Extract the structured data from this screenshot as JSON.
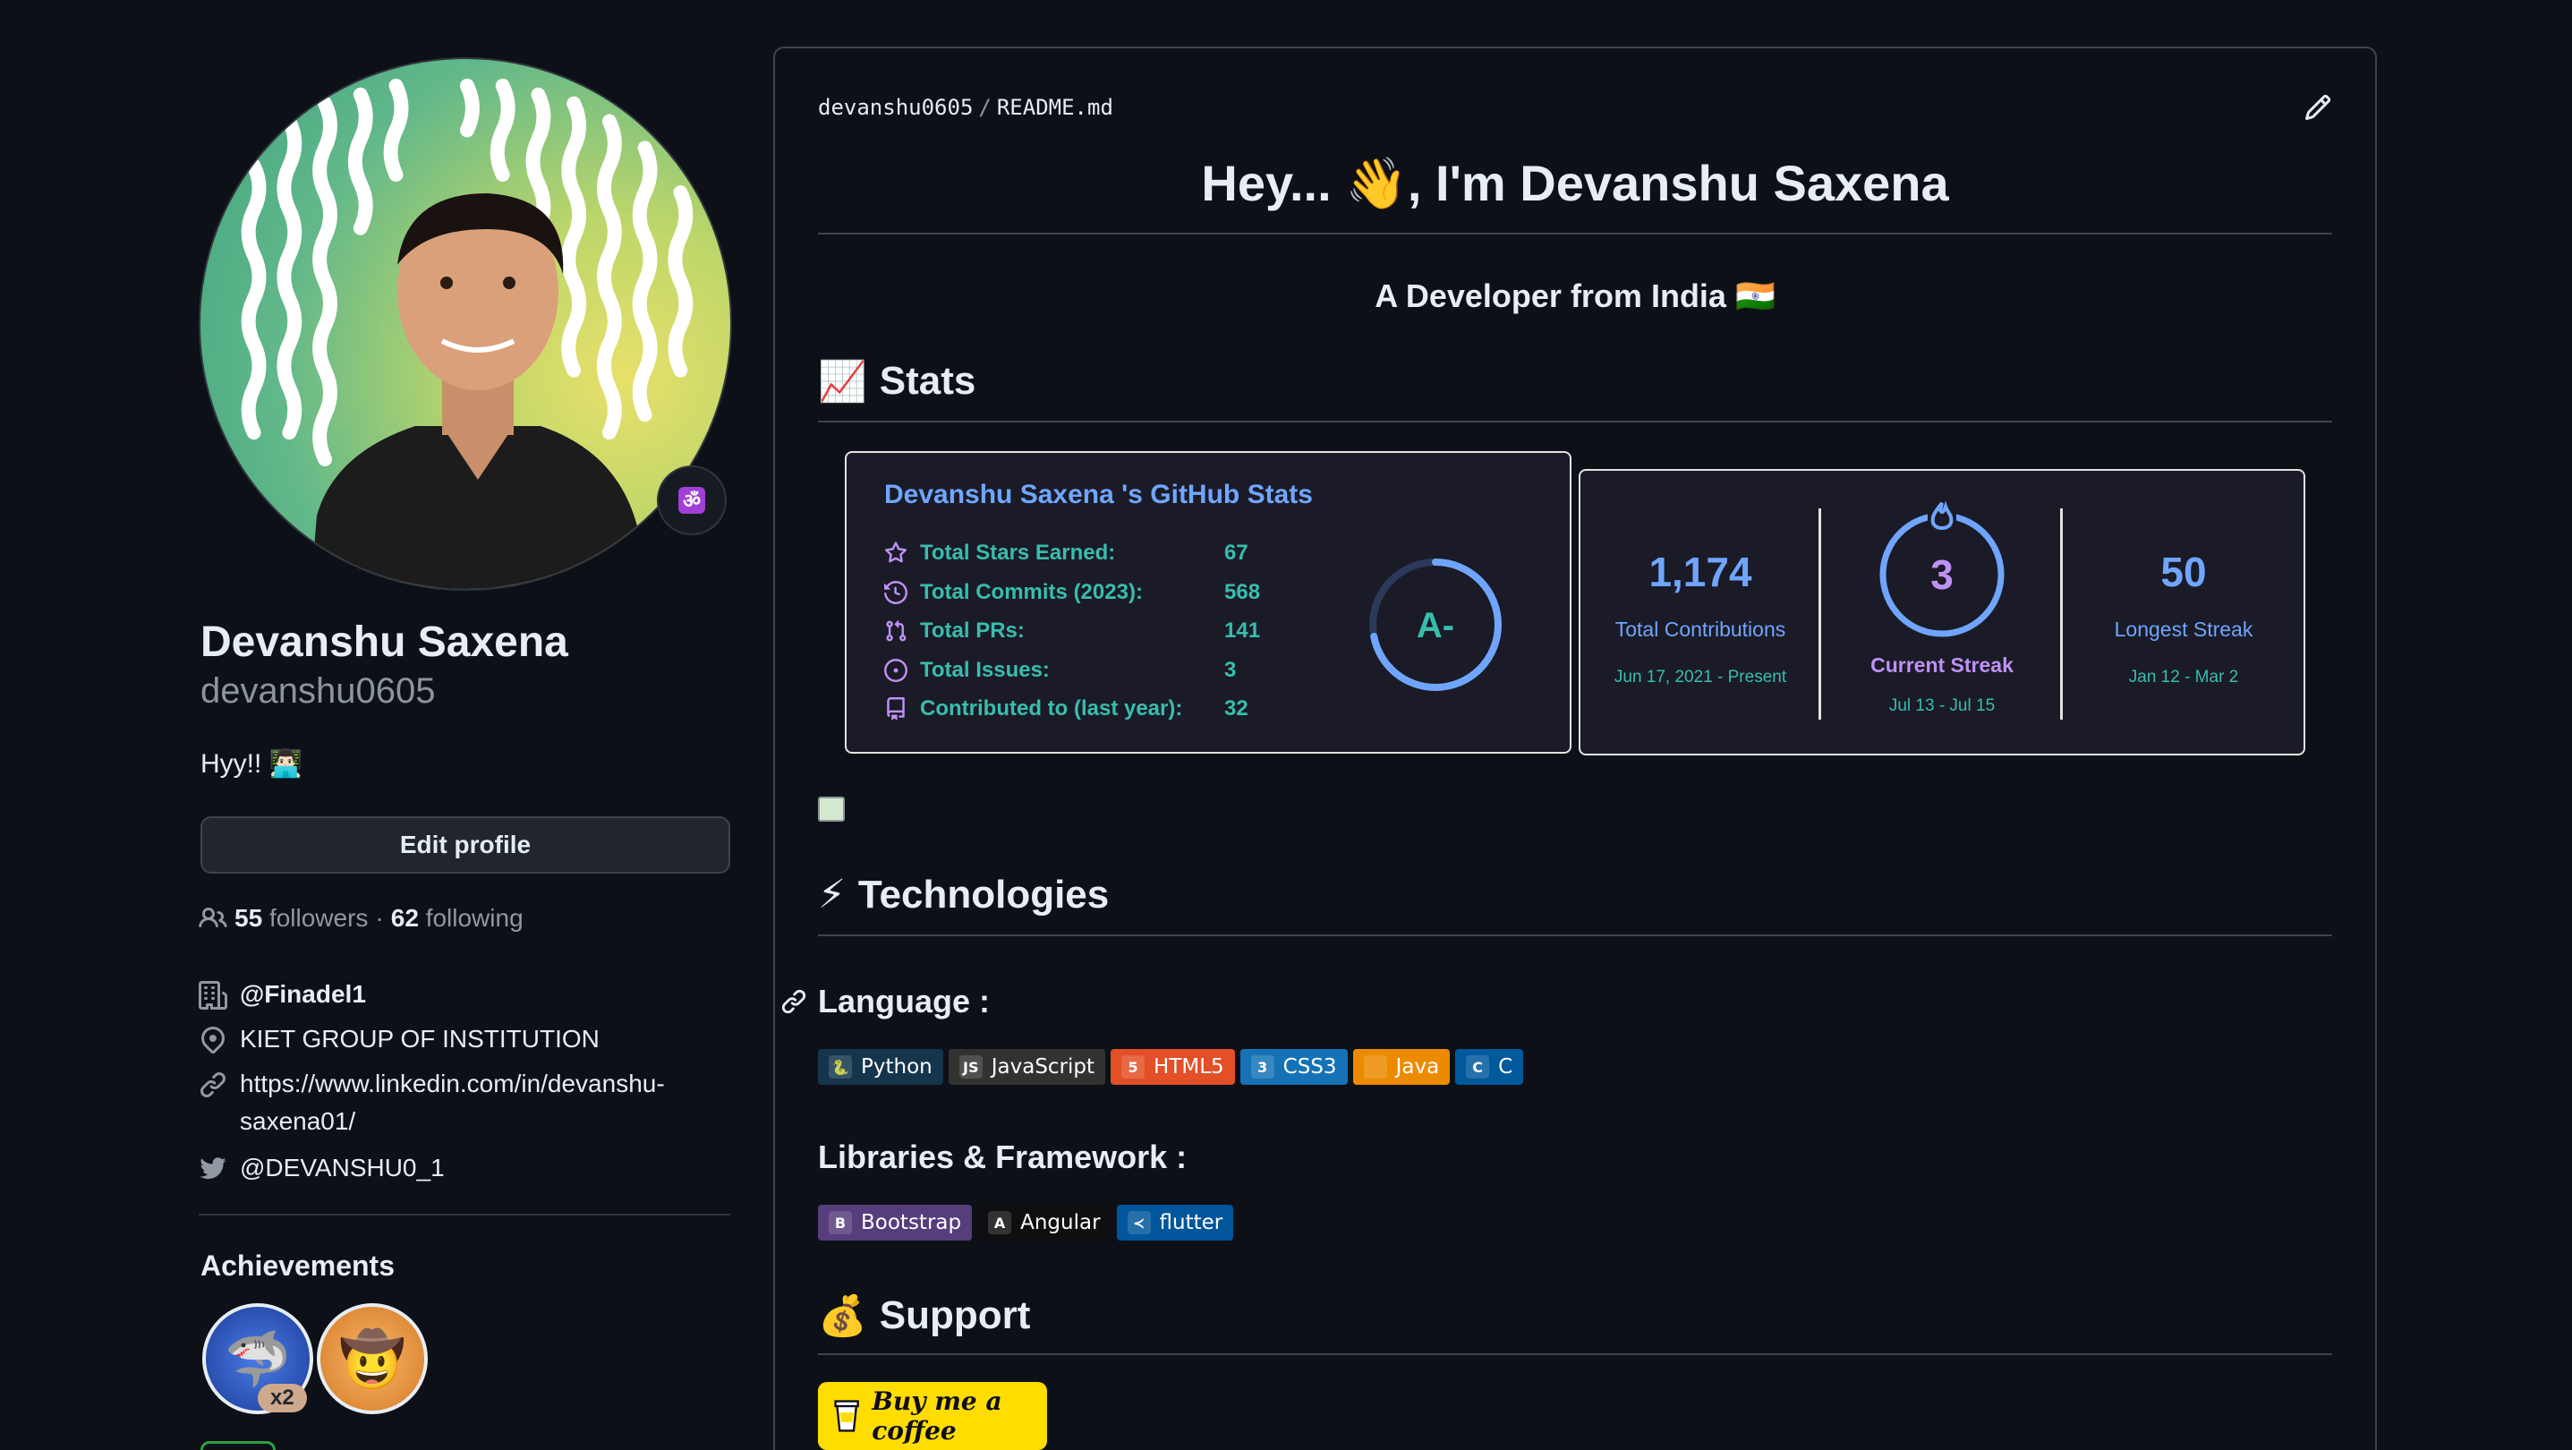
{
  "profile": {
    "full_name": "Devanshu Saxena",
    "username": "devanshu0605",
    "bio": "Hyy!! 👨🏻‍💻",
    "status_emoji": "ॐ",
    "edit_profile_label": "Edit profile",
    "followers_count": "55",
    "followers_label": "followers",
    "separator": "·",
    "following_count": "62",
    "following_label": "following",
    "organization": "@Finadel1",
    "location": "KIET GROUP OF INSTITUTION",
    "website_line1": "https://www.linkedin.com/in/devanshu-",
    "website_line2": "saxena01/",
    "twitter": "@DEVANSHU0_1",
    "achievements_title": "Achievements",
    "achievement_multiplier": "x2"
  },
  "readme": {
    "path_owner": "devanshu0605",
    "path_sep": "/",
    "path_file": "README.md",
    "heading": "Hey... 👋, I'm Devanshu Saxena",
    "subtitle": "A Developer from India 🇮🇳",
    "stats_heading_emoji": "📈",
    "stats_heading": "Stats",
    "tech_heading_emoji": "⚡",
    "tech_heading": "Technologies",
    "language_heading": "Language :",
    "libraries_heading": "Libraries & Framework :",
    "support_heading_emoji": "💰",
    "support_heading": "Support",
    "coffee_label": "Buy me a coffee"
  },
  "github_stats": {
    "title": "Devanshu Saxena 's GitHub Stats",
    "rows": [
      {
        "label": "Total Stars Earned:",
        "value": "67",
        "icon": "star-icon"
      },
      {
        "label": "Total Commits (2023):",
        "value": "568",
        "icon": "history-icon"
      },
      {
        "label": "Total PRs:",
        "value": "141",
        "icon": "pull-request-icon"
      },
      {
        "label": "Total Issues:",
        "value": "3",
        "icon": "issue-icon"
      },
      {
        "label": "Contributed to (last year):",
        "value": "32",
        "icon": "repo-icon"
      }
    ],
    "rank": "A-",
    "rank_progress": 0.72,
    "colors": {
      "title": "#70a5fd",
      "text": "#38bdae",
      "icon": "#bf91f3",
      "bg": "#1a1b27"
    }
  },
  "streak": {
    "total": "1,174",
    "total_label": "Total Contributions",
    "total_range": "Jun 17, 2021 - Present",
    "current": "3",
    "current_label": "Current Streak",
    "current_range": "Jul 13 - Jul 15",
    "longest": "50",
    "longest_label": "Longest Streak",
    "longest_range": "Jan 12 - Mar 2"
  },
  "languages": [
    {
      "label": "Python",
      "bg": "#14354c",
      "icon": "python-icon",
      "glyph": "🐍"
    },
    {
      "label": "JavaScript",
      "bg": "#323330",
      "icon": "javascript-icon",
      "glyph": "JS"
    },
    {
      "label": "HTML5",
      "bg": "#e34f26",
      "icon": "html5-icon",
      "glyph": "5"
    },
    {
      "label": "CSS3",
      "bg": "#1572b6",
      "icon": "css3-icon",
      "glyph": "3"
    },
    {
      "label": "Java",
      "bg": "#ed8b00",
      "icon": "java-icon",
      "glyph": ""
    },
    {
      "label": "C",
      "bg": "#00599c",
      "icon": "c-icon",
      "glyph": "C"
    }
  ],
  "libraries": [
    {
      "label": "Bootstrap",
      "bg": "#563d7c",
      "icon": "bootstrap-icon",
      "glyph": "B"
    },
    {
      "label": "Angular",
      "bg": "#0f0f11",
      "icon": "angular-icon",
      "glyph": "A"
    },
    {
      "label": "flutter",
      "bg": "#02569b",
      "icon": "flutter-icon",
      "glyph": "≺"
    }
  ]
}
